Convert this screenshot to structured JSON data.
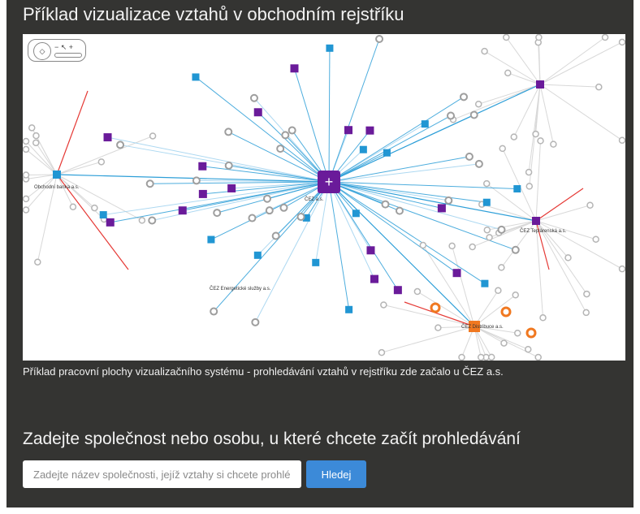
{
  "page": {
    "title": "Příklad vizualizace vztahů v obchodním rejstříku",
    "caption": "Příklad pracovní plochy vizualizačního systému - prohledávání vztahů v rejstříku zde začalo u ČEZ a.s.",
    "prompt": "Zadejte společnost nebo osobu, u které chcete začít prohledávání"
  },
  "search": {
    "placeholder": "Zadejte název společnosti, jejíž vztahy si chcete prohlédnout",
    "value": ""
  },
  "button": {
    "label": "Hledej"
  },
  "viz_controls": {
    "pad": "◇",
    "zoom": "− ↖ +"
  },
  "graph": {
    "labels": [
      "ČEZ a.s.",
      "Obchodní banka a.s.",
      "ČEZ Teplárenská a.s.",
      "ČEZ Energetické služby a.s.",
      "ČEZ Distribuce a.s."
    ]
  },
  "colors": {
    "background": "#343432",
    "hub": "#6a1b9a",
    "company": "#2196d3",
    "person": "#9e9e9e",
    "orange_node": "#f07820",
    "edge_blue": "#2e9fd8",
    "edge_red": "#e53935",
    "button": "#3c8ad8"
  }
}
